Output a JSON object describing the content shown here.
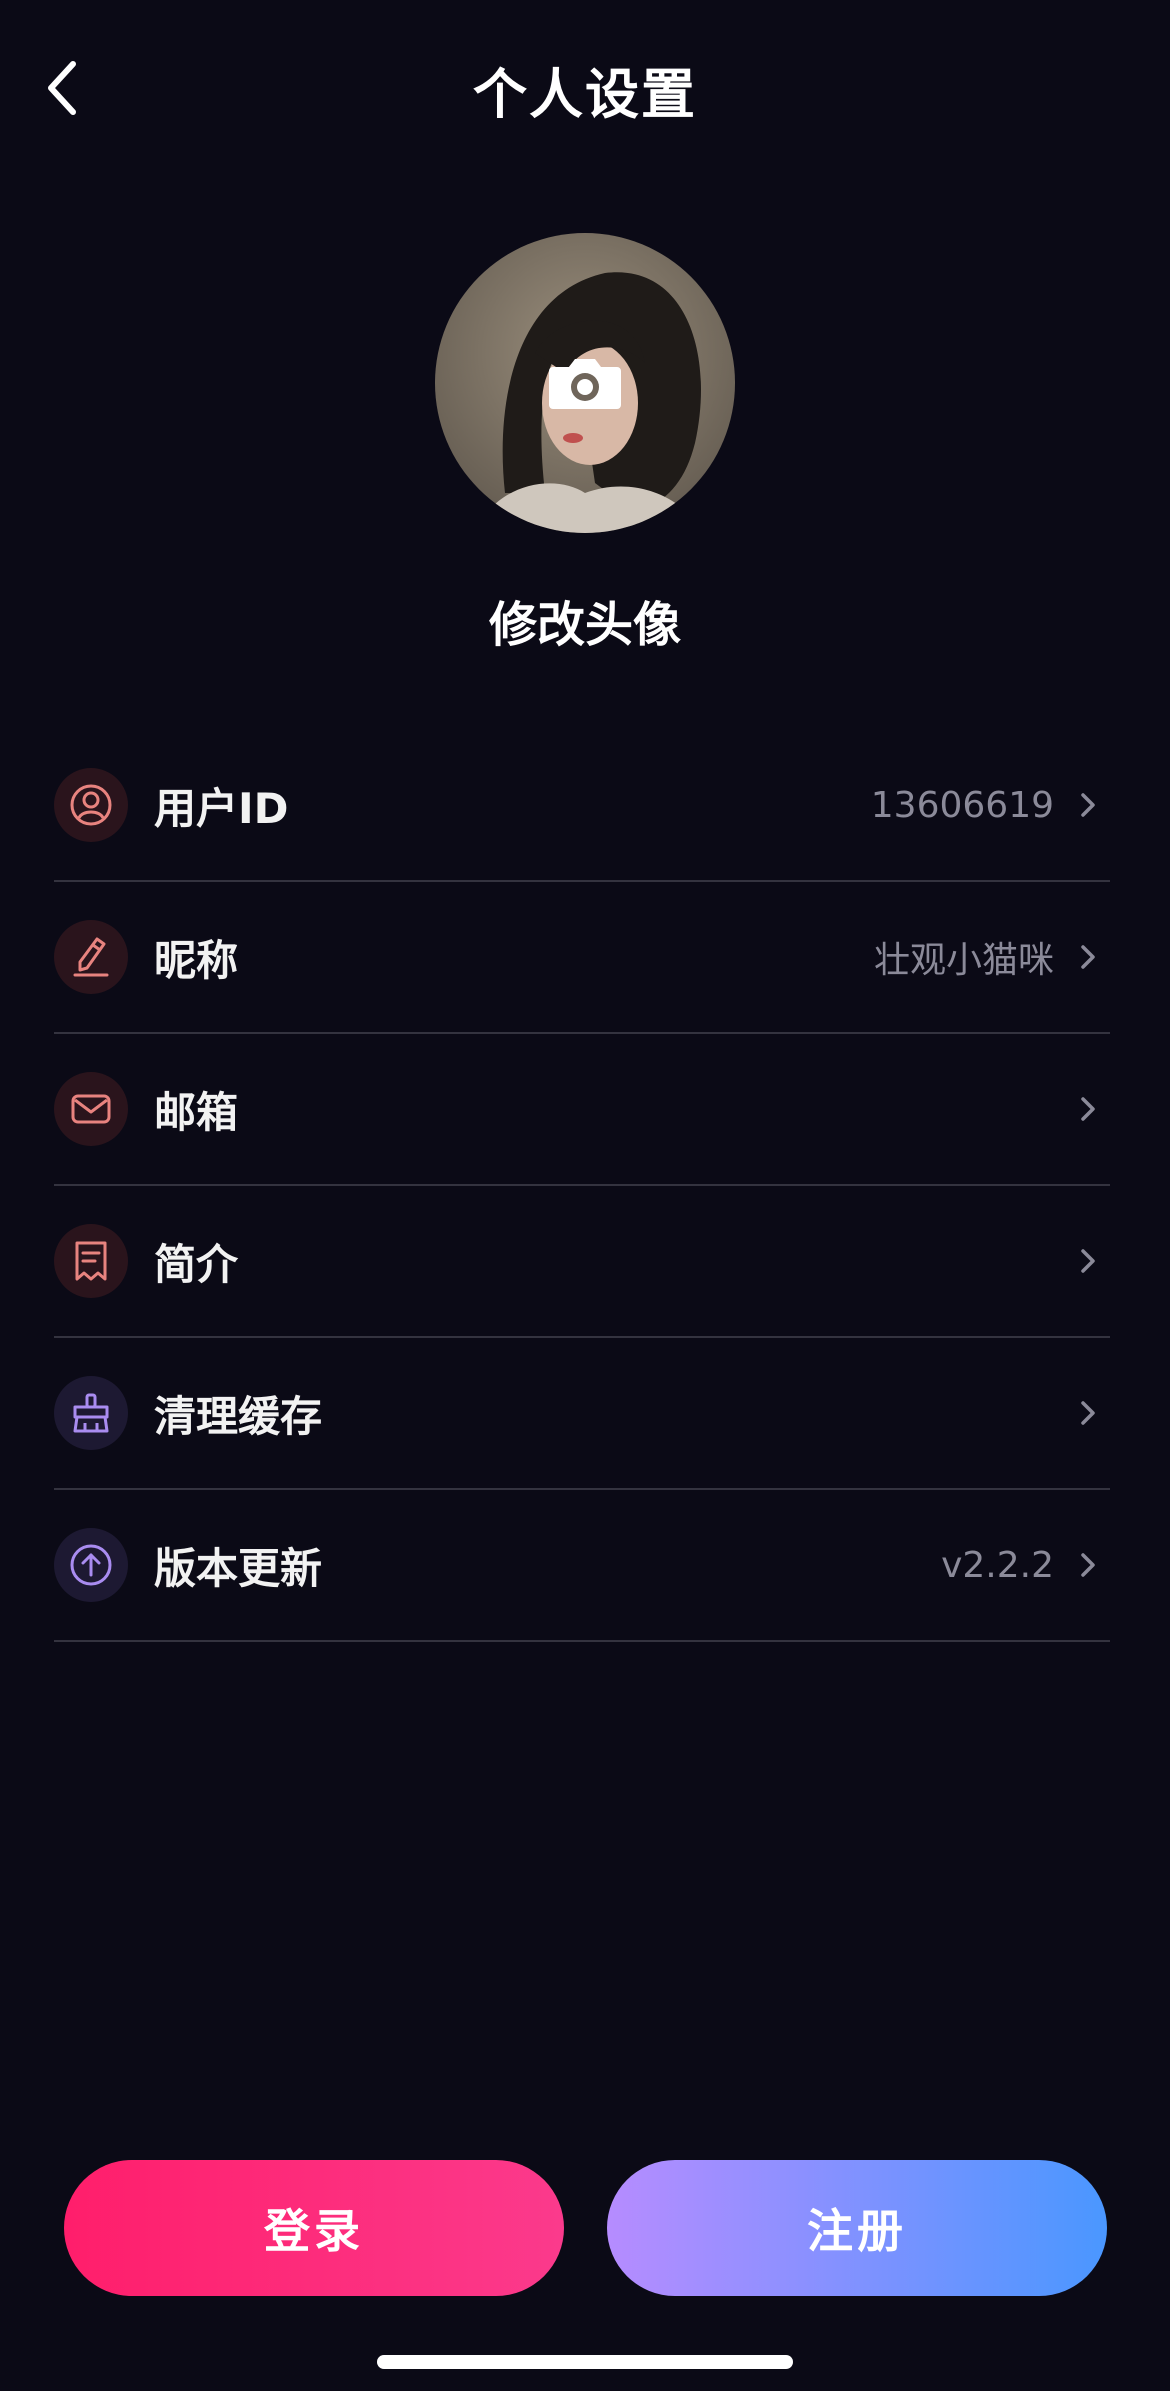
{
  "header": {
    "title": "个人设置"
  },
  "avatar": {
    "label": "修改头像"
  },
  "settings": [
    {
      "label": "用户ID",
      "value": "13606619",
      "icon": "user-icon"
    },
    {
      "label": "昵称",
      "value": "壮观小猫咪",
      "icon": "pencil-icon"
    },
    {
      "label": "邮箱",
      "value": "",
      "icon": "mail-icon"
    },
    {
      "label": "简介",
      "value": "",
      "icon": "bio-icon"
    },
    {
      "label": "清理缓存",
      "value": "",
      "icon": "broom-icon"
    },
    {
      "label": "版本更新",
      "value": "v2.2.2",
      "icon": "upload-icon"
    }
  ],
  "buttons": {
    "login": "登录",
    "register": "注册"
  },
  "colors": {
    "background": "#0b0a16",
    "login_gradient": [
      "#ff1e6b",
      "#fb3a8c"
    ],
    "register_gradient": [
      "#b68cff",
      "#4a97ff"
    ],
    "icon_red": "#e8837f",
    "icon_purple": "#a98cf0"
  }
}
